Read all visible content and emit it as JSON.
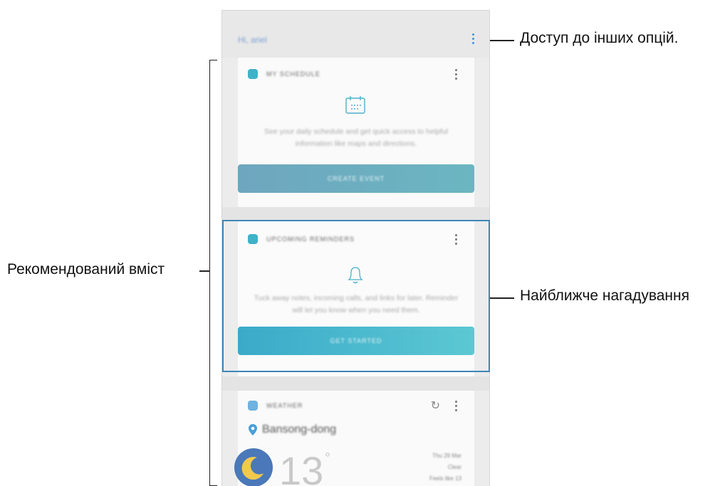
{
  "annotations": {
    "more_options": "Доступ до інших опцій.",
    "recommended_content": "Рекомендований вміст",
    "upcoming_reminder": "Найближче нагадування"
  },
  "header": {
    "greeting": "Hi, ariel"
  },
  "cards": {
    "schedule": {
      "title": "MY SCHEDULE",
      "icon": "calendar-icon",
      "description": "See your daily schedule and get quick access to helpful information like maps and directions.",
      "button": "CREATE EVENT"
    },
    "reminders": {
      "title": "UPCOMING REMINDERS",
      "icon": "bell-icon",
      "description": "Tuck away notes, incoming calls, and links for later. Reminder will let you know when you need them.",
      "button": "GET STARTED"
    },
    "weather": {
      "title": "WEATHER",
      "icon": "cloud-icon",
      "location": "Bansong-dong",
      "temperature": "13",
      "degree": "°",
      "side_info": [
        "Thu 29 Mar",
        "Clear",
        "Feels like 13"
      ]
    }
  },
  "colors": {
    "accent": "#3fb2c8",
    "highlight_border": "#3f86b8",
    "button_schedule_start": "#6ea6bf",
    "button_reminder_start": "#3aaac9"
  }
}
